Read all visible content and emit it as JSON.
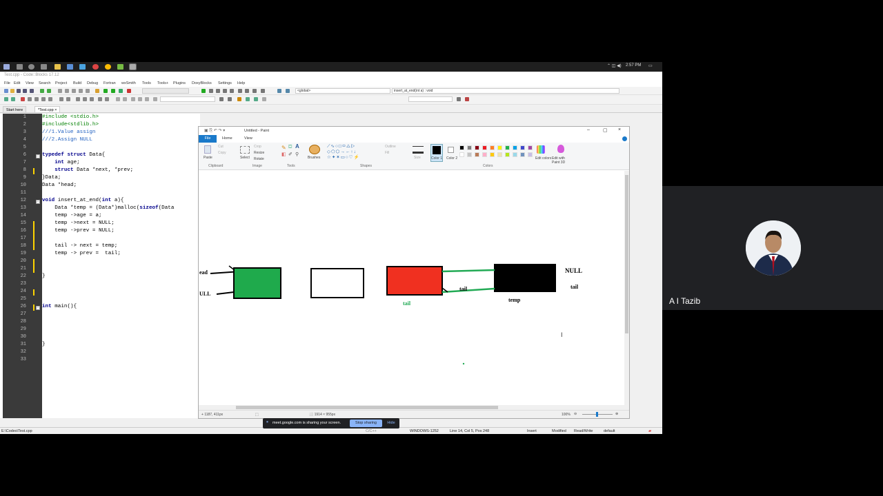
{
  "taskbar": {
    "time": "2:57 PM",
    "icons": [
      "windows-start-icon",
      "search-icon",
      "cortana-icon",
      "task-view-icon",
      "file-explorer-icon",
      "app-icon",
      "app-icon",
      "chrome-icon",
      "chrome-icon",
      "codeblocks-icon",
      "paint-icon"
    ]
  },
  "codeblocks": {
    "window_title": "Test.cpp - Code::Blocks 17.12",
    "menu": [
      "File",
      "Edit",
      "View",
      "Search",
      "Project",
      "Build",
      "Debug",
      "Fortran",
      "wxSmith",
      "Tools",
      "Tools+",
      "Plugins",
      "DoxyBlocks",
      "Settings",
      "Help"
    ],
    "scope_combo": "<global>",
    "function_combo": "insert_at_end(int a) : void",
    "tabs": [
      "Start here",
      "*Test.cpp"
    ],
    "line_numbers": [
      "1",
      "2",
      "3",
      "4",
      "5",
      "6",
      "7",
      "8",
      "9",
      "10",
      "11",
      "12",
      "13",
      "14",
      "15",
      "16",
      "17",
      "18",
      "19",
      "20",
      "21",
      "22",
      "23",
      "24",
      "25",
      "26",
      "27",
      "28",
      "29",
      "30",
      "31",
      "32",
      "33"
    ],
    "status": {
      "file_path": "E:\\Codes\\Test.cpp",
      "language": "C/C++",
      "encoding": "WINDOWS-1252",
      "position": "Line 14, Col 5, Pos 248",
      "mode": "Insert",
      "modified": "Modified",
      "access": "Read/Write",
      "profile": "default"
    }
  },
  "code": {
    "l1": "#include <stdio.h>",
    "l2": "#include<stdlib.h>",
    "l3": "///1.Value assign",
    "l4": "///2.Assign NULL",
    "l6_kw1": "typedef struct",
    "l6_rest": " Data{",
    "l7_kw": "int",
    "l7_rest": " age;",
    "l8_kw": "struct",
    "l8_rest": " Data *next, *prev;",
    "l9": "}Data;",
    "l10": "Data *head;",
    "l12_kw": "void",
    "l12_mid": " insert_at_end(",
    "l12_kw2": "int",
    "l12_rest": " a){",
    "l13_a": "    Data *temp = (Data*)malloc(",
    "l13_kw": "sizeof",
    "l13_b": "(Data",
    "l14": "    temp ->age = a;",
    "l15": "    temp ->next = NULL;",
    "l16": "    temp ->prev = NULL;",
    "l18": "    tail -> next = temp;",
    "l19": "    temp -> prev =  tail;",
    "l22": "}",
    "l26_kw": "int",
    "l26_rest": " main(){",
    "l31": "}"
  },
  "paint": {
    "title": "Untitled - Paint",
    "tabs": [
      "File",
      "Home",
      "View"
    ],
    "groups": [
      "Clipboard",
      "Image",
      "Tools",
      "Shapes",
      "Colors"
    ],
    "buttons": {
      "paste": "Paste",
      "cut": "Cut",
      "copy": "Copy",
      "select": "Select",
      "crop": "Crop",
      "resize": "Resize",
      "rotate": "Rotate",
      "brushes": "Brushes",
      "outline": "Outline",
      "fill": "Fill",
      "size": "Size",
      "color1": "Color 1",
      "color2": "Color 2",
      "edit_colors": "Edit colors",
      "edit_paint3d": "Edit with Paint 3D"
    },
    "palette": [
      "#000000",
      "#7f7f7f",
      "#880015",
      "#ed1c24",
      "#ff7f27",
      "#fff200",
      "#22b14c",
      "#00a2e8",
      "#3f48cc",
      "#a349a4",
      "#ffffff",
      "#c3c3c3",
      "#b97a57",
      "#ffaec9",
      "#ffc90e",
      "#efe4b0",
      "#b5e61d",
      "#99d9ea",
      "#7092be",
      "#c8bfe7"
    ],
    "cursor_pos": "1187, 411px",
    "canvas_size": "1914 × 955px",
    "zoom": "100%",
    "drawing_labels": {
      "head": "ead",
      "null_left": "ULL",
      "null_right": "NULL",
      "tail_right": "tail",
      "tail_green": "tail",
      "tail_mid": "tail",
      "temp": "temp"
    },
    "colors": {
      "green_node": "#1faa4c",
      "red_node": "#f03020",
      "black_node": "#000000",
      "green_line": "#22aa55"
    }
  },
  "share_banner": {
    "message": "meet.google.com is sharing your screen.",
    "stop": "Stop sharing",
    "hide": "Hide"
  },
  "participant": {
    "name": "A I Tazib"
  }
}
